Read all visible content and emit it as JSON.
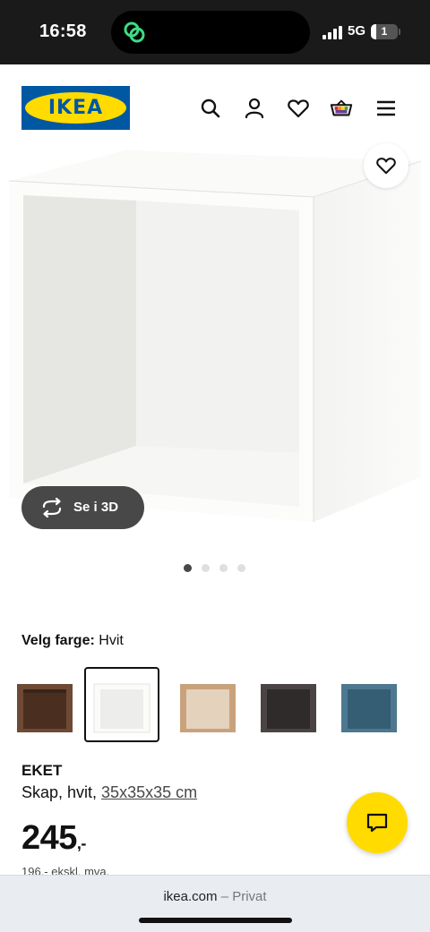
{
  "status_bar": {
    "time": "16:58",
    "network": "5G",
    "battery": "1"
  },
  "header": {
    "logo_text": "IKEA",
    "icons": [
      "search-icon",
      "profile-icon",
      "heart-icon",
      "shopping-bag-icon",
      "menu-icon"
    ]
  },
  "gallery": {
    "view_3d_label": "Se i 3D",
    "image_count": 4,
    "active_image": 1
  },
  "color_selector": {
    "label": "Velg farge:",
    "selected": "Hvit",
    "options": [
      {
        "name": "walnut",
        "color": "#6e4a34"
      },
      {
        "name": "white",
        "color": "#f5f5f2"
      },
      {
        "name": "oak",
        "color": "#c9a27c"
      },
      {
        "name": "dark-grey",
        "color": "#4a4544"
      },
      {
        "name": "blue",
        "color": "#4d7890"
      }
    ],
    "selected_index": 1
  },
  "product": {
    "name": "EKET",
    "description": "Skap, hvit, ",
    "dimensions": "35x35x35 cm",
    "price": "245",
    "price_suffix": ",-",
    "price_ex_vat": "196,- ekskl. mva."
  },
  "browser": {
    "domain": "ikea.com",
    "separator": " – ",
    "mode": "Privat"
  },
  "colors": {
    "ikea_blue": "#0058a3",
    "ikea_yellow": "#ffdb00"
  }
}
